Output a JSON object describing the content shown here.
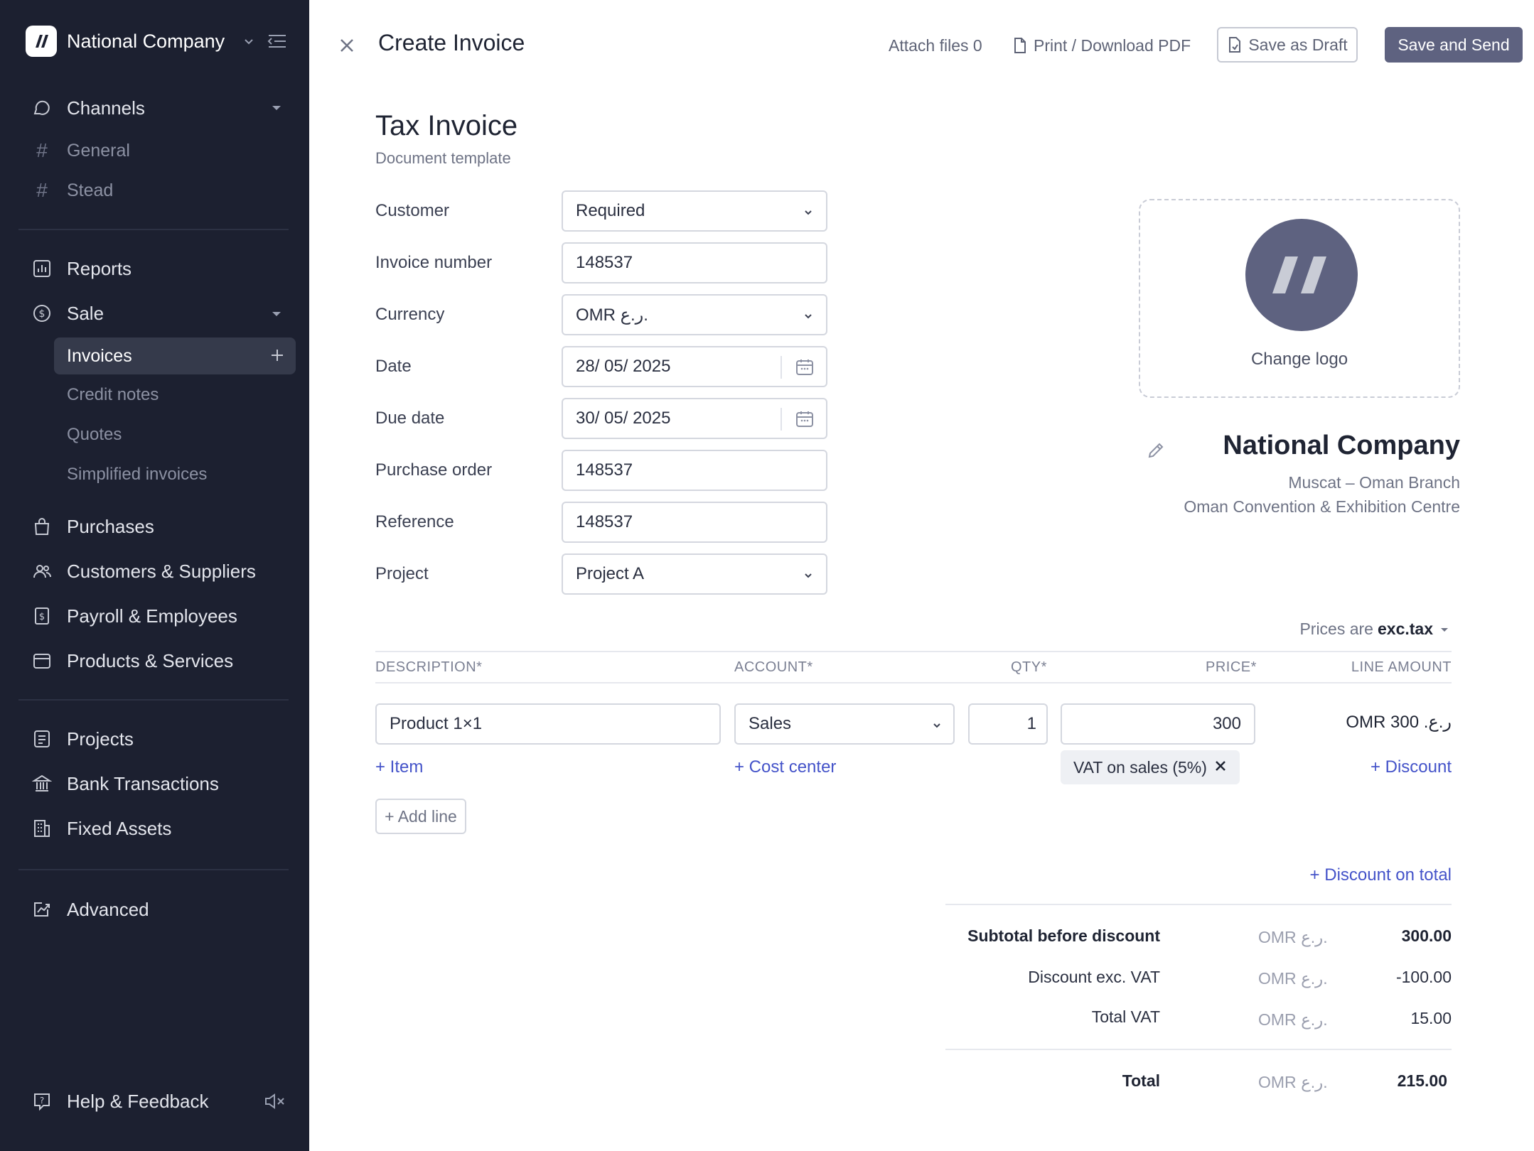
{
  "sidebar": {
    "company": "National Company",
    "channels": {
      "label": "Channels",
      "items": [
        "General",
        "Stead"
      ]
    },
    "reports": "Reports",
    "sale": {
      "label": "Sale",
      "items": [
        "Invoices",
        "Credit notes",
        "Quotes",
        "Simplified invoices"
      ],
      "active": "Invoices"
    },
    "purchases": "Purchases",
    "customers": "Customers & Suppliers",
    "payroll": "Payroll & Employees",
    "products": "Products & Services",
    "projects": "Projects",
    "bank": "Bank Transactions",
    "assets": "Fixed Assets",
    "advanced": "Advanced",
    "help": "Help & Feedback"
  },
  "topbar": {
    "title": "Create Invoice",
    "attach": "Attach files 0",
    "print": "Print / Download PDF",
    "draft": "Save as Draft",
    "send": "Save and Send"
  },
  "doc": {
    "title": "Tax Invoice",
    "subtitle": "Document template"
  },
  "form": {
    "customer": {
      "label": "Customer",
      "value": "Required"
    },
    "invoice_number": {
      "label": "Invoice number",
      "value": "148537"
    },
    "currency": {
      "label": "Currency",
      "value": "OMR ر.ع."
    },
    "date": {
      "label": "Date",
      "value": "28/ 05/ 2025"
    },
    "due_date": {
      "label": "Due date",
      "value": "30/ 05/ 2025"
    },
    "purchase_order": {
      "label": "Purchase order",
      "value": "148537"
    },
    "reference": {
      "label": "Reference",
      "value": "148537"
    },
    "project": {
      "label": "Project",
      "value": "Project A"
    }
  },
  "logo": {
    "change": "Change logo"
  },
  "company": {
    "name": "National Company",
    "line1": "Muscat – Oman Branch",
    "line2": "Oman Convention & Exhibition Centre"
  },
  "table": {
    "prices_prefix": "Prices are",
    "prices_mode": "exc.tax",
    "headers": {
      "description": "DESCRIPTION*",
      "account": "ACCOUNT*",
      "qty": "QTY*",
      "price": "PRICE*",
      "amount": "LINE AMOUNT"
    },
    "row": {
      "description": "Product 1×1",
      "account": "Sales",
      "qty": "1",
      "price": "300",
      "amount": "OMR ر.ع. 300",
      "vat": "VAT on sales (5%)"
    },
    "add_item": "+ Item",
    "add_cost_center": "+ Cost center",
    "add_discount": "+ Discount",
    "add_line": "+ Add line",
    "discount_total": "+ Discount on total"
  },
  "summary": {
    "currency": "OMR ر.ع.",
    "subtotal": {
      "label": "Subtotal before discount",
      "value": "300.00"
    },
    "discount": {
      "label": "Discount exc. VAT",
      "value": "-100.00"
    },
    "vat": {
      "label": "Total VAT",
      "value": "15.00"
    },
    "total": {
      "label": "Total",
      "value": "215.00"
    }
  }
}
